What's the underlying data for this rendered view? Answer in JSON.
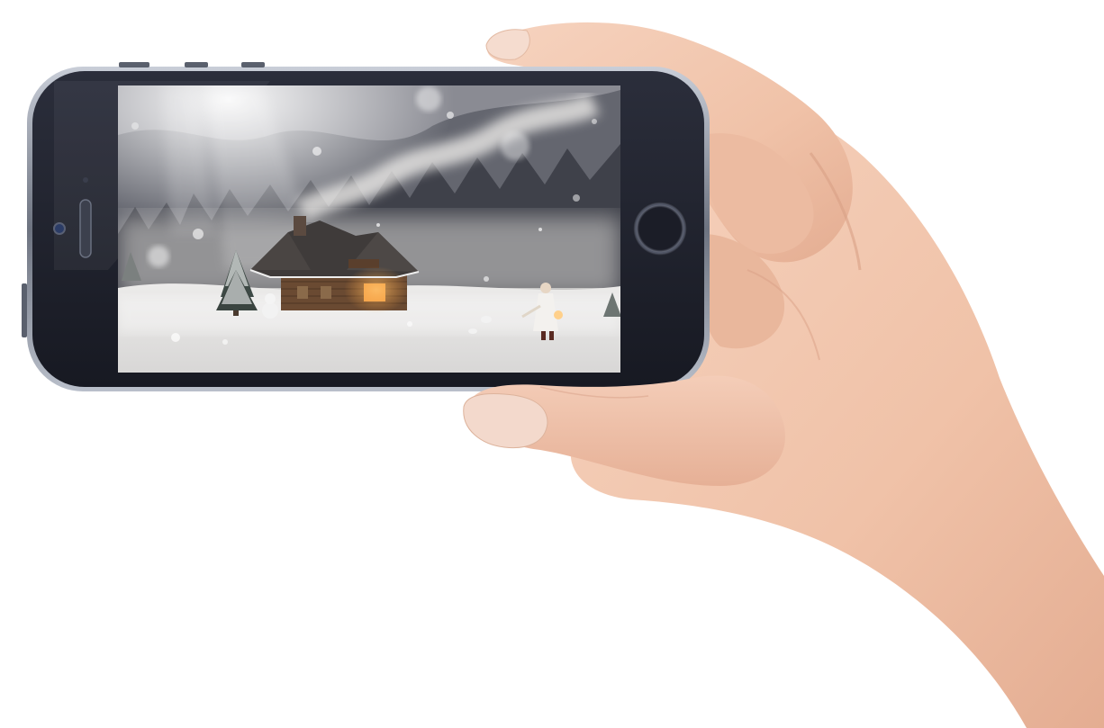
{
  "scene": {
    "device": "smartphone-landscape",
    "screen_content": "winter-cabin-photo",
    "colors": {
      "background": "#ffffff",
      "phone_body": "#1f2230",
      "phone_edge": "#6d7380",
      "skin": "#f2c7b0",
      "skin_shadow": "#dca48a",
      "snow": "#e9e8e6",
      "cabin_wall": "#6a4a32",
      "cabin_roof": "#3f3b3a",
      "window_glow": "#f2a24a",
      "sky_light": "#f4f0ea",
      "forest": "#4a4c55"
    },
    "icons": [
      "front-camera-icon",
      "earpiece-icon",
      "home-button-icon",
      "volume-button-icon"
    ]
  }
}
